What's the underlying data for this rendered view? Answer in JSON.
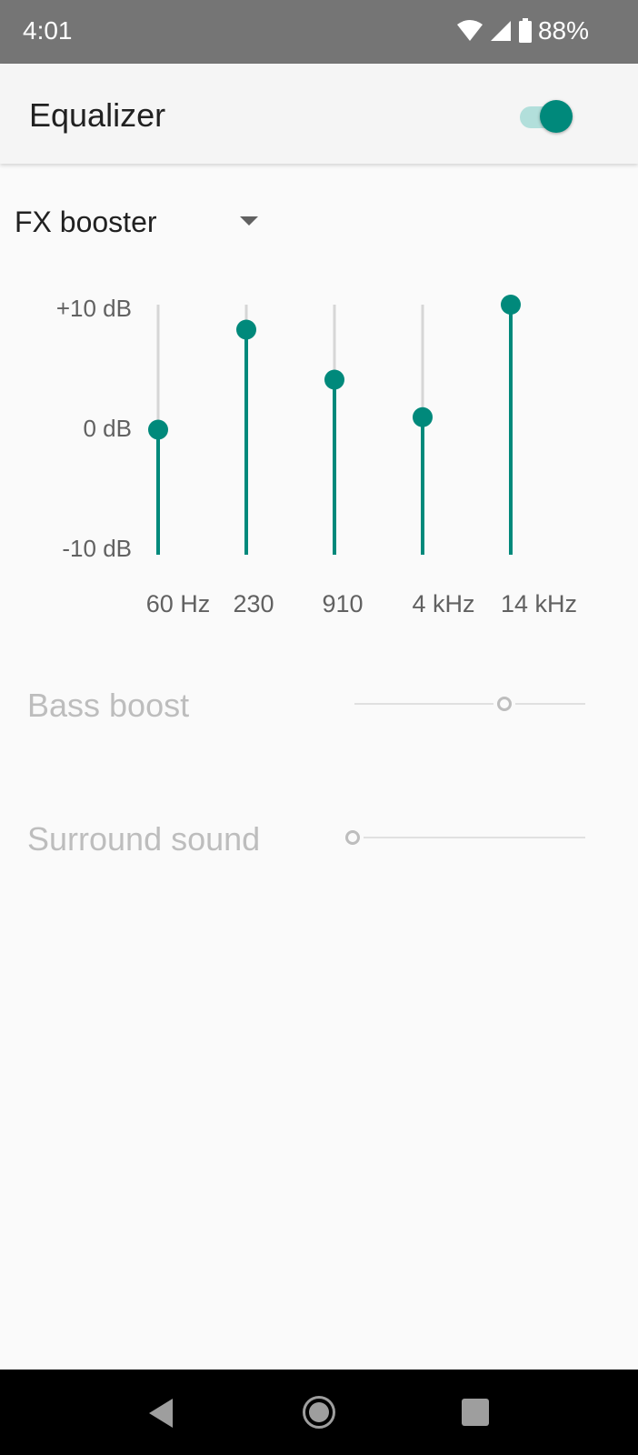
{
  "status_bar": {
    "time": "4:01",
    "battery": "88%",
    "icons": [
      "wifi-icon",
      "signal-icon",
      "battery-icon"
    ]
  },
  "app_bar": {
    "title": "Equalizer",
    "toggle_on": true
  },
  "preset": {
    "selected": "FX booster"
  },
  "equalizer": {
    "db_labels": [
      "+10 dB",
      "0 dB",
      "-10 dB"
    ],
    "range_db": [
      -10,
      10
    ],
    "bands": [
      {
        "label": "60 Hz",
        "level_db": 0
      },
      {
        "label": "230",
        "level_db": 8
      },
      {
        "label": "910",
        "level_db": 4
      },
      {
        "label": "4 kHz",
        "level_db": 1
      },
      {
        "label": "14 kHz",
        "level_db": 10
      }
    ]
  },
  "effects": {
    "bass_boost": {
      "label": "Bass boost",
      "level": 0.66,
      "enabled": false
    },
    "surround_sound": {
      "label": "Surround sound",
      "level": 0.0,
      "enabled": false
    }
  },
  "colors": {
    "accent": "#00897b",
    "accent_light": "#b2dfdb",
    "disabled": "#bdbdbd"
  },
  "nav_bar": {
    "buttons": [
      "back-icon",
      "home-icon",
      "recents-icon"
    ]
  }
}
